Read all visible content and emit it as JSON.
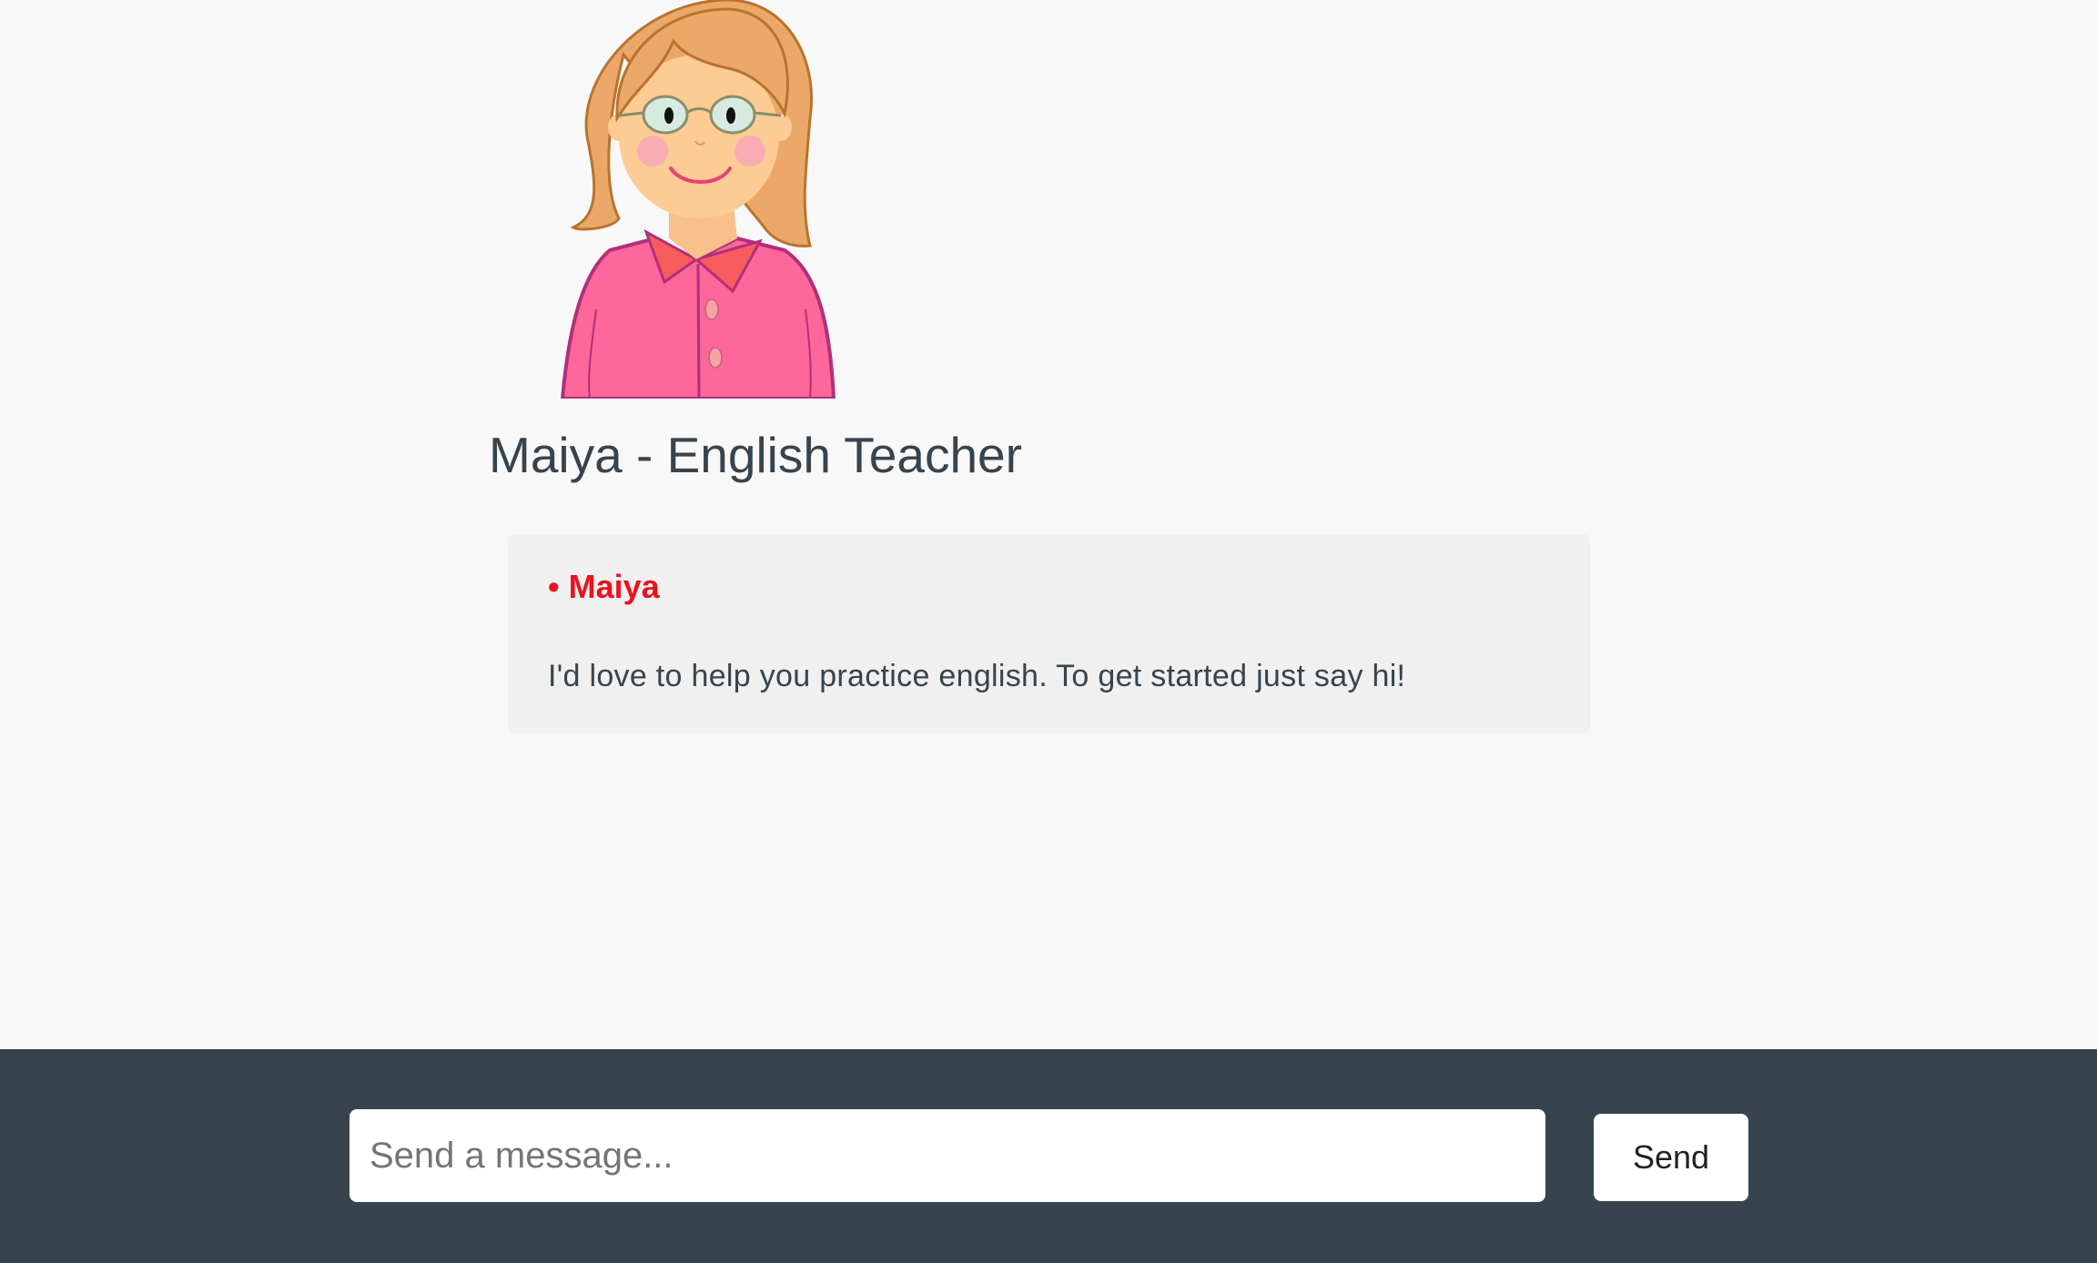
{
  "teacher": {
    "title": "Maiya - English Teacher",
    "avatar_icon": "teacher-avatar-illustration"
  },
  "messages": [
    {
      "bullet": "•",
      "sender": "Maiya",
      "text": "I'd love to help you practice english. To get started just say hi!"
    }
  ],
  "composer": {
    "placeholder": "Send a message...",
    "value": "",
    "send_label": "Send"
  },
  "colors": {
    "background": "#f8f8f8",
    "footer": "#37444d",
    "title_text": "#37444d",
    "sender_accent": "#e8131e",
    "message_bubble": "#f0f0f0",
    "shirt": "#ff6699",
    "hair": "#eba868"
  }
}
